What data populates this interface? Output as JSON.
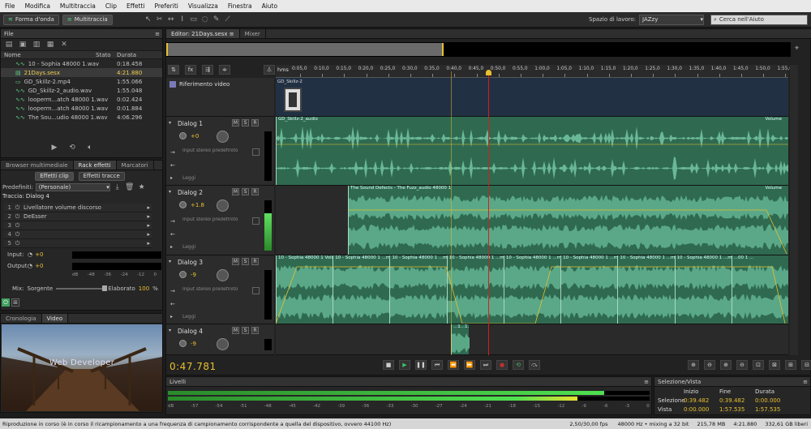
{
  "menu": [
    "File",
    "Modifica",
    "Multitraccia",
    "Clip",
    "Effetti",
    "Preferiti",
    "Visualizza",
    "Finestra",
    "Aiuto"
  ],
  "toolbar": {
    "waveform_label": "Forma d'onda",
    "multitrack_label": "Multitraccia",
    "workspace_label": "Spazio di lavoro:",
    "workspace_value": "JAZzy",
    "search_placeholder": "Cerca nell'Aiuto"
  },
  "files": {
    "title": "File",
    "columns": {
      "name": "Nome",
      "state": "Stato",
      "duration": "Durata"
    },
    "items": [
      {
        "name": "10 - Sophia 48000 1.wav",
        "duration": "0:18.458",
        "icon": "audio-icon"
      },
      {
        "name": "21Days.sesx",
        "duration": "4:21.880",
        "icon": "session-icon",
        "selected": true
      },
      {
        "name": "GD_Skillz-2.mp4",
        "duration": "1:55.066",
        "icon": "video-icon"
      },
      {
        "name": "GD_Skillz-2_audio.wav",
        "duration": "1:55.048",
        "icon": "audio-icon"
      },
      {
        "name": "looperm...atch 48000 1.wav",
        "duration": "0:02.424",
        "icon": "audio-icon"
      },
      {
        "name": "looperm...atch 48000 1.wav",
        "duration": "0:01.884",
        "icon": "audio-icon"
      },
      {
        "name": "The Sou...udio 48000 1.wav",
        "duration": "4:06.296",
        "icon": "audio-icon"
      }
    ]
  },
  "effects": {
    "tabs": [
      "Browser multimediale",
      "Rack effetti",
      "Marcatori"
    ],
    "subtabs": [
      "Effetti clip",
      "Effetti tracce"
    ],
    "preset_label": "Predefiniti:",
    "preset_value": "(Personale)",
    "track_label": "Traccia: Dialog 4",
    "slots": [
      {
        "n": "1",
        "name": "Livellatore volume discorso"
      },
      {
        "n": "2",
        "name": "DeEsser"
      },
      {
        "n": "3",
        "name": ""
      },
      {
        "n": "4",
        "name": ""
      },
      {
        "n": "5",
        "name": ""
      }
    ],
    "input_label": "Input:",
    "input_value": "+0",
    "output_label": "Output:",
    "output_value": "+0",
    "meter_ticks": [
      "dB",
      "-48",
      "-36",
      "-24",
      "-12",
      "0"
    ],
    "mix_label": "Mix:",
    "mix_source": "Sorgente",
    "mix_processed": "Elaborato",
    "mix_value": "100",
    "mix_unit": "%"
  },
  "bottom_left": {
    "tabs": [
      "Cronologia",
      "Video"
    ],
    "video_text": "Web Developer"
  },
  "editor": {
    "tabs": [
      "Editor: 21Days.sesx",
      "Mixer"
    ],
    "ruler": {
      "unit": "hms",
      "labels": [
        "0:05,0",
        "0:10,0",
        "0:15,0",
        "0:20,0",
        "0:25,0",
        "0:30,0",
        "0:35,0",
        "0:40,0",
        "0:45,0",
        "0:50,0",
        "0:55,0",
        "1:00,0",
        "1:05,0",
        "1:10,0",
        "1:15,0",
        "1:20,0",
        "1:25,0",
        "1:30,0",
        "1:35,0",
        "1:40,0",
        "1:45,0",
        "1:50,0",
        "1:55,0"
      ]
    },
    "video_track": {
      "name": "Riferimento video",
      "clip": "GD_Skillz-2"
    },
    "tracks": [
      {
        "name": "Dialog 1",
        "vol": "+0",
        "input": "Input stereo predefinito",
        "mode": "Leggi",
        "clips": [
          {
            "label": "GD_Skillz-2_audio",
            "env": "Volume"
          }
        ]
      },
      {
        "name": "Dialog 2",
        "vol": "+1.8",
        "input": "Input stereo predefinito",
        "mode": "Leggi",
        "clips": [
          {
            "label": "The Sound Defects - The Fuzz_audio 48000 1",
            "env": "Volume"
          }
        ]
      },
      {
        "name": "Dialog 3",
        "vol": "-9",
        "input": "Input stereo predefinito",
        "mode": "Leggi",
        "clips": [
          {
            "label": "10 - Sophia 48000 1 Volume"
          },
          {
            "label": "10 - Sophia 48000 1 ...me"
          },
          {
            "label": "10 - Sophia 48000 1 ...me"
          },
          {
            "label": "10 - Sophia 48000 1 ...me"
          },
          {
            "label": "10 - Sophia 48000 1 ...me"
          },
          {
            "label": "10 - Sophia 48000 1 ...me"
          },
          {
            "label": "10 - Sophia 48000 1 ...me"
          },
          {
            "label": "10 - Sophia 48000 1 ...me"
          },
          {
            "label": "...00 1 ..."
          }
        ]
      },
      {
        "name": "Dialog 4",
        "vol": "-9",
        "clips": [
          {
            "label": "...1...1..."
          }
        ]
      }
    ],
    "msr": [
      "M",
      "S",
      "R"
    ],
    "time": "0:47.781"
  },
  "levels": {
    "title": "Livelli",
    "ticks": [
      "dB",
      "-57",
      "-54",
      "-51",
      "-48",
      "-45",
      "-42",
      "-39",
      "-36",
      "-33",
      "-30",
      "-27",
      "-24",
      "-21",
      "-18",
      "-15",
      "-12",
      "-9",
      "-6",
      "-3",
      "0"
    ],
    "left_fill": 0.905,
    "right_fill": 0.85
  },
  "selection": {
    "title": "Selezione/Vista",
    "headers": [
      "Inizio",
      "Fine",
      "Durata"
    ],
    "rows": [
      {
        "label": "Selezione",
        "start": "0:39.482",
        "end": "0:39.482",
        "dur": "0:00.000"
      },
      {
        "label": "Vista",
        "start": "0:00.000",
        "end": "1:57.535",
        "dur": "1:57.535"
      }
    ]
  },
  "status": {
    "message": "Riproduzione in corso (è in corso il ricampionamento a una frequenza di campionamento corrispondente a quella del dispositivo, ovvero 44100 Hz)",
    "fps": "2,50/30,00 fps",
    "format": "48000 Hz • mixing a 32 bit",
    "size": "215,78 MB",
    "duration": "4:21.880",
    "free": "332,61 GB liberi"
  },
  "colors": {
    "accent": "#e8c030",
    "wave": "#2f6a50",
    "playhead": "#d02020"
  }
}
